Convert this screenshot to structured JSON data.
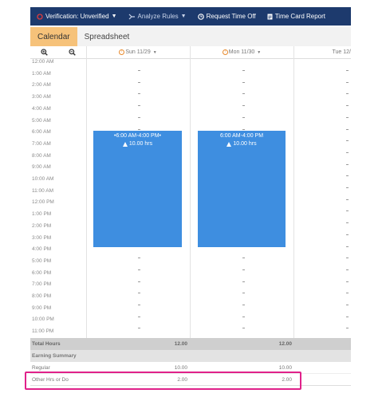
{
  "toolbar": {
    "verification": "Verification: Unverified",
    "analyze": "Analyze Rules",
    "request": "Request Time Off",
    "report": "Time Card Report"
  },
  "tabs": [
    {
      "label": "Calendar",
      "active": true
    },
    {
      "label": "Spreadsheet",
      "active": false
    }
  ],
  "days": [
    {
      "label": "Sun 11/29",
      "warning": true
    },
    {
      "label": "Mon 11/30",
      "warning": true
    },
    {
      "label": "Tue 12/",
      "warning": false
    }
  ],
  "times": [
    "12:00 AM",
    "1:00 AM",
    "2:00 AM",
    "3:00 AM",
    "4:00 AM",
    "5:00 AM",
    "6:00 AM",
    "7:00 AM",
    "8:00 AM",
    "9:00 AM",
    "10:00 AM",
    "11:00 AM",
    "12:00 PM",
    "1:00 PM",
    "2:00 PM",
    "3:00 PM",
    "4:00 PM",
    "5:00 PM",
    "6:00 PM",
    "7:00 PM",
    "8:00 PM",
    "9:00 PM",
    "10:00 PM",
    "11:00 PM"
  ],
  "shifts": [
    {
      "time": "•6:00 AM-4:00 PM•",
      "hours": "10.00 hrs"
    },
    {
      "time": "6:00 AM-4:00 PM",
      "hours": "10.00 hrs"
    }
  ],
  "summary": {
    "total_label": "Total Hours",
    "total_sun": "12.00",
    "total_mon": "12.00",
    "earning_label": "Earning Summary",
    "regular_label": "Regular",
    "regular_sun": "10.00",
    "regular_mon": "10.00",
    "other_label": "Other Hrs or Do",
    "other_sun": "2.00",
    "other_mon": "2.00"
  },
  "colors": {
    "toolbar": "#1d3a6d",
    "active_tab": "#f6c27a",
    "shift": "#3e8ee0",
    "highlight": "#e0218a"
  }
}
